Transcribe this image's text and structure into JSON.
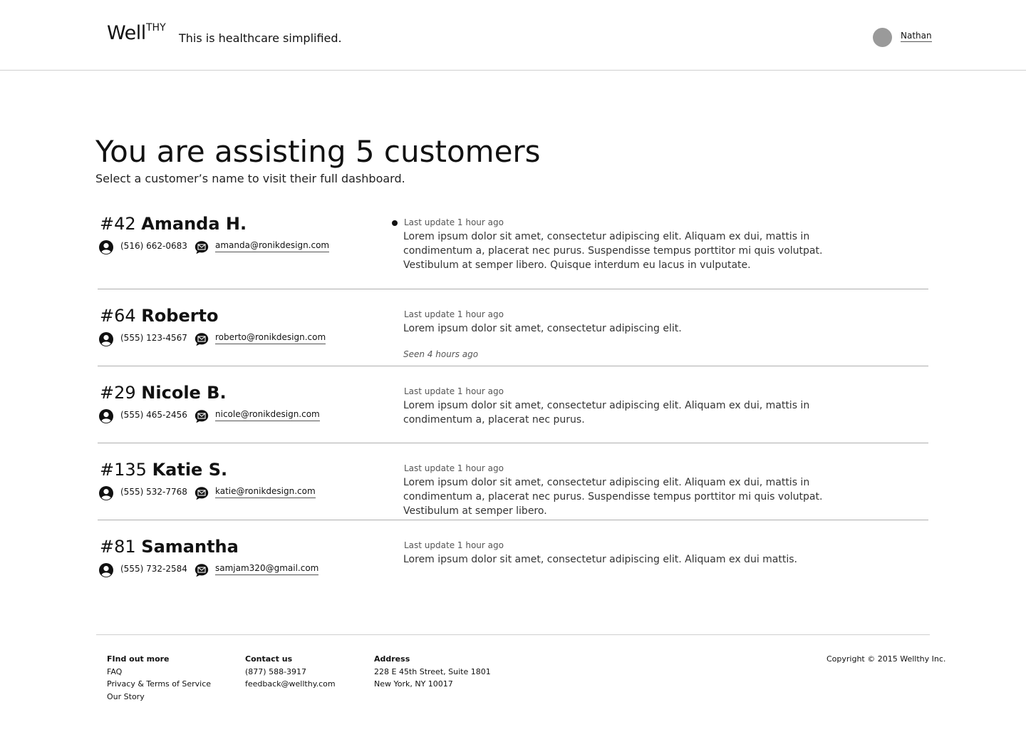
{
  "header": {
    "logo_main": "Well",
    "logo_sup": "THY",
    "tagline": "This is healthcare simplified.",
    "user_name": "Nathan"
  },
  "main": {
    "title": "You are assisting 5 customers",
    "subtitle": "Select a customer’s name to visit their full dashboard."
  },
  "customers": [
    {
      "id": "#42",
      "name": "Amanda H.",
      "phone": "(516) 662-0683",
      "email": "amanda@ronikdesign.com",
      "unread": true,
      "last_update": "Last update 1 hour ago",
      "update_text": "Lorem ipsum dolor sit amet, consectetur adipiscing elit. Aliquam ex dui, mattis in condimentum a, placerat nec purus. Suspendisse tempus porttitor mi quis volutpat. Vestibulum at semper libero. Quisque interdum eu lacus in vulputate.",
      "seen": ""
    },
    {
      "id": "#64",
      "name": "Roberto",
      "phone": "(555) 123-4567",
      "email": "roberto@ronikdesign.com",
      "unread": false,
      "last_update": "Last update 1 hour ago",
      "update_text": "Lorem ipsum dolor sit amet, consectetur adipiscing elit.",
      "seen": "Seen 4 hours ago"
    },
    {
      "id": "#29",
      "name": "Nicole B.",
      "phone": "(555) 465-2456",
      "email": "nicole@ronikdesign.com",
      "unread": false,
      "last_update": "Last update 1 hour ago",
      "update_text": "Lorem ipsum dolor sit amet, consectetur adipiscing elit. Aliquam ex dui, mattis in condimentum a, placerat nec purus.",
      "seen": ""
    },
    {
      "id": "#135",
      "name": "Katie S.",
      "phone": "(555) 532-7768",
      "email": "katie@ronikdesign.com",
      "unread": false,
      "last_update": "Last update 1 hour ago",
      "update_text": "Lorem ipsum dolor sit amet, consectetur adipiscing elit. Aliquam ex dui, mattis in condimentum a, placerat nec purus. Suspendisse tempus porttitor mi quis volutpat. Vestibulum at semper libero.",
      "seen": ""
    },
    {
      "id": "#81",
      "name": "Samantha",
      "phone": "(555) 732-2584",
      "email": "samjam320@gmail.com",
      "unread": false,
      "last_update": "Last update 1 hour ago",
      "update_text": "Lorem ipsum dolor sit amet, consectetur adipiscing elit. Aliquam ex dui mattis.",
      "seen": ""
    }
  ],
  "footer": {
    "find_out_more": {
      "heading": "FInd out more",
      "links": [
        "FAQ",
        "Privacy & Terms of Service",
        "Our Story"
      ]
    },
    "contact": {
      "heading": "Contact us",
      "phone": "(877) 588-3917",
      "email": "feedback@wellthy.com"
    },
    "address": {
      "heading": "Address",
      "line1": "228 E 45th Street, Suite 1801",
      "line2": "New York, NY 10017"
    },
    "copyright": "Copyright © 2015 Wellthy Inc."
  },
  "icons": {
    "phone": "person-icon",
    "email": "envelope-icon",
    "unread": "unread-dot-icon"
  },
  "colors": {
    "text": "#111111",
    "divider": "#aeaeae",
    "avatar": "#9a9a9a"
  }
}
